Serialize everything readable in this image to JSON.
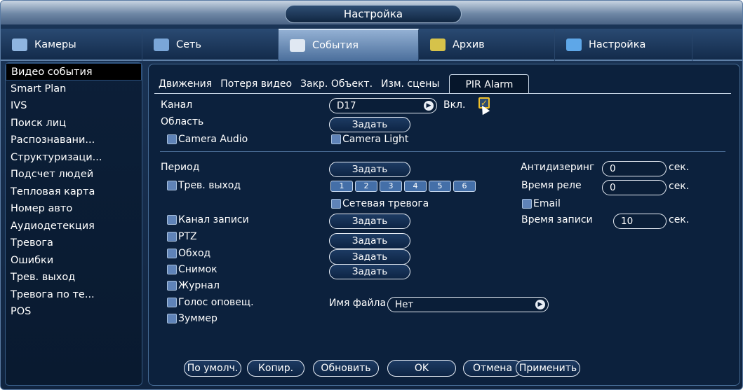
{
  "window": {
    "title": "Настройка"
  },
  "top_tabs": [
    {
      "label": "Камеры",
      "icon": "camera-icon"
    },
    {
      "label": "Сеть",
      "icon": "network-icon"
    },
    {
      "label": "События",
      "icon": "events-icon"
    },
    {
      "label": "Архив",
      "icon": "archive-icon"
    },
    {
      "label": "Настройка",
      "icon": "settings-icon"
    }
  ],
  "sidebar": {
    "items": [
      "Видео события",
      "Smart Plan",
      "IVS",
      "Поиск лиц",
      "Распознавани...",
      "Структуризаци...",
      "Подсчет людей",
      "Тепловая карта",
      "Номер авто",
      "Аудиодетекция",
      "Тревога",
      "Ошибки",
      "Трев. выход",
      "Тревога по те...",
      "POS"
    ]
  },
  "subtabs": [
    "Движения",
    "Потеря видео",
    "Закр. Объект.",
    "Изм. сцены",
    "PIR Alarm"
  ],
  "form": {
    "channel_label": "Канал",
    "channel_value": "D17",
    "enable_label": "Вкл.",
    "area_label": "Область",
    "set_label": "Задать",
    "camera_audio": "Camera Audio",
    "camera_light": "Camera Light",
    "period_label": "Период",
    "alarm_out_label": "Трев. выход",
    "outputs": [
      "1",
      "2",
      "3",
      "4",
      "5",
      "6"
    ],
    "antidither_label": "Антидизеринг",
    "antidither_value": "0",
    "relay_time_label": "Время реле",
    "relay_time_value": "0",
    "unit_sec": "сек.",
    "network_alarm": "Сетевая тревога",
    "email": "Email",
    "record_channel_label": "Канал записи",
    "record_time_label": "Время записи",
    "record_time_value": "10",
    "ptz_label": "PTZ",
    "tour_label": "Обход",
    "snapshot_label": "Снимок",
    "log_label": "Журнал",
    "voice_label": "Голос оповещ.",
    "file_name_label": "Имя файла",
    "file_name_value": "Нет",
    "buzzer_label": "Зуммер"
  },
  "bottom_buttons": [
    "По умолч.",
    "Копир.",
    "Обновить",
    "OK",
    "Отмена",
    "Применить"
  ]
}
